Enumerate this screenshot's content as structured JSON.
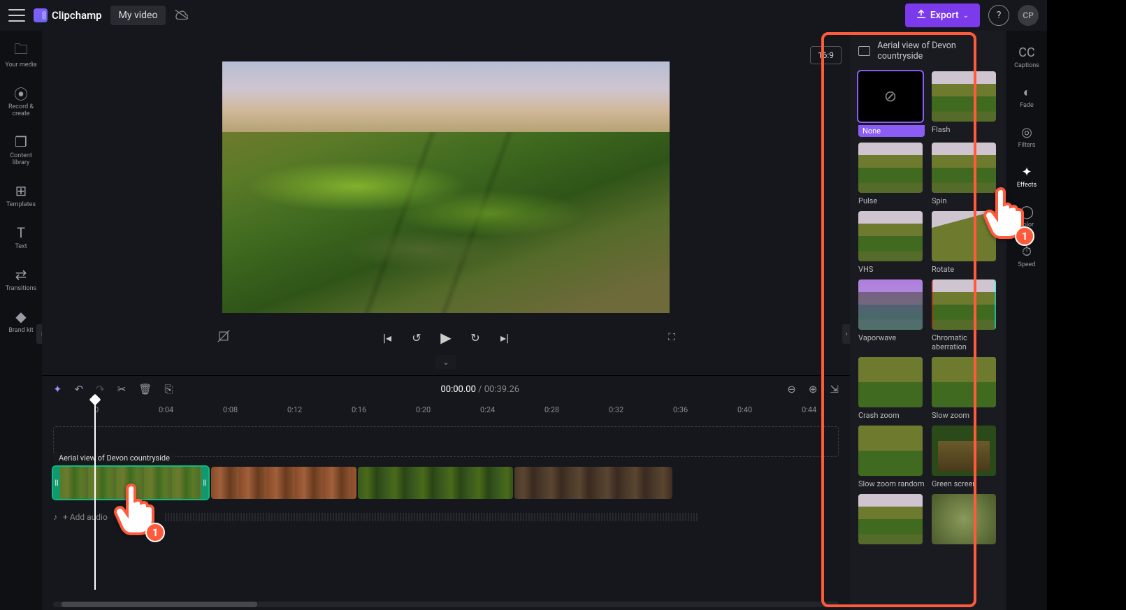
{
  "header": {
    "brand": "Clipchamp",
    "project": "My video",
    "export": "Export",
    "avatar": "CP"
  },
  "leftSidebar": [
    {
      "name": "your-media",
      "label": "Your media",
      "icon": "🗀"
    },
    {
      "name": "record-create",
      "label": "Record & create",
      "icon": "⦿"
    },
    {
      "name": "content-library",
      "label": "Content library",
      "icon": "❐"
    },
    {
      "name": "templates",
      "label": "Templates",
      "icon": "⊞"
    },
    {
      "name": "text",
      "label": "Text",
      "icon": "T"
    },
    {
      "name": "transitions",
      "label": "Transitions",
      "icon": "⇄"
    },
    {
      "name": "brand-kit",
      "label": "Brand kit",
      "icon": "◆"
    }
  ],
  "stage": {
    "aspect": "16:9"
  },
  "transport": {
    "current": "00:00.00",
    "duration": "00:39.26"
  },
  "ruler": [
    "0",
    "0:04",
    "0:08",
    "0:12",
    "0:16",
    "0:20",
    "0:24",
    "0:28",
    "0:32",
    "0:36",
    "0:40",
    "0:44"
  ],
  "timeline": {
    "clipLabel": "Aerial view of Devon countryside",
    "audioAdd": "+ Add audio"
  },
  "effectsPanel": {
    "title": "Aerial view of Devon countryside",
    "items": [
      {
        "name": "none",
        "label": "None",
        "selected": true
      },
      {
        "name": "flash",
        "label": "Flash"
      },
      {
        "name": "pulse",
        "label": "Pulse"
      },
      {
        "name": "spin",
        "label": "Spin"
      },
      {
        "name": "vhs",
        "label": "VHS"
      },
      {
        "name": "rotate",
        "label": "Rotate"
      },
      {
        "name": "vaporwave",
        "label": "Vaporwave"
      },
      {
        "name": "chromatic",
        "label": "Chromatic aberration"
      },
      {
        "name": "crash-zoom",
        "label": "Crash zoom"
      },
      {
        "name": "slow-zoom",
        "label": "Slow zoom"
      },
      {
        "name": "slow-zoom-random",
        "label": "Slow zoom random"
      },
      {
        "name": "green-screen",
        "label": "Green screen"
      },
      {
        "name": "blur-1",
        "label": ""
      },
      {
        "name": "blur-2",
        "label": ""
      }
    ]
  },
  "rightSidebar": [
    {
      "name": "captions",
      "label": "Captions",
      "icon": "CC"
    },
    {
      "name": "fade",
      "label": "Fade",
      "icon": "◐"
    },
    {
      "name": "filters",
      "label": "Filters",
      "icon": "◎"
    },
    {
      "name": "effects",
      "label": "Effects",
      "icon": "✦",
      "active": true
    },
    {
      "name": "color",
      "label": "color",
      "icon": "◯"
    },
    {
      "name": "speed",
      "label": "Speed",
      "icon": "⏱"
    }
  ],
  "annotations": {
    "badge": "1"
  }
}
